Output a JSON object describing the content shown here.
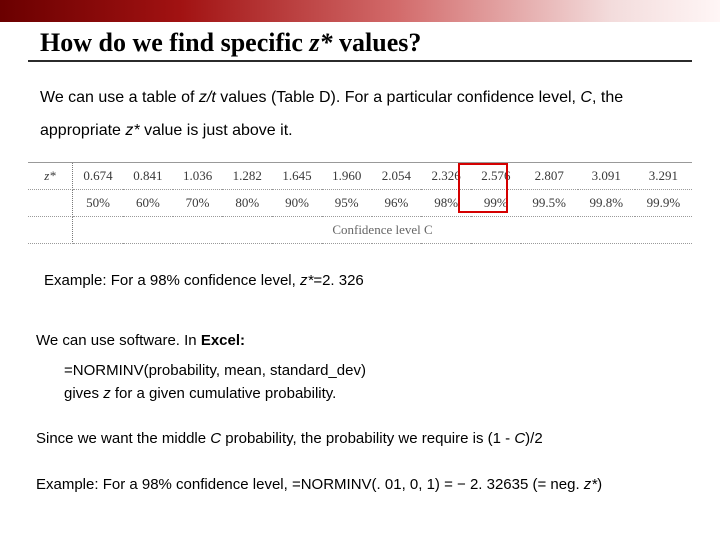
{
  "header": {
    "title_pre": "How do we find specific ",
    "title_z": "z*",
    "title_post": " values?"
  },
  "body": {
    "p1_a": "We can use a table of ",
    "p1_b": "z/t",
    "p1_c": " values (Table D). For a particular confidence level, ",
    "p1_d": "C",
    "p1_e": ", the appropriate ",
    "p1_f": "z*",
    "p1_g": " value is just above it."
  },
  "table": {
    "row1_label": "z*",
    "row2_label": "",
    "caption": "Confidence level C",
    "z": [
      "0.674",
      "0.841",
      "1.036",
      "1.282",
      "1.645",
      "1.960",
      "2.054",
      "2.326",
      "2.576",
      "2.807",
      "3.091",
      "3.291"
    ],
    "c": [
      "50%",
      "60%",
      "70%",
      "80%",
      "90%",
      "95%",
      "96%",
      "98%",
      "99%",
      "99.5%",
      "99.8%",
      "99.9%"
    ]
  },
  "example1": {
    "a": "Example: For a 98% confidence level, ",
    "b": "z*",
    "c": "=2. 326"
  },
  "software": {
    "line": "We can use software. In ",
    "bold": "Excel:"
  },
  "excel": {
    "l1": "=NORMINV(probability, mean, standard_dev)",
    "l2a": "gives ",
    "l2b": "z",
    "l2c": " for a given cumulative probability."
  },
  "middle": {
    "a": "Since we want the middle ",
    "b": "C",
    "c": " probability, the probability we require is (1 - ",
    "d": "C",
    "e": ")/2"
  },
  "example2": {
    "a": "Example: For a 98% confidence level, =NORMINV(. 01, 0, 1) = − 2. 32635 (= neg. ",
    "b": "z*",
    "c": ")"
  },
  "chart_data": {
    "type": "table",
    "title": "z* critical values for confidence level C",
    "columns": [
      "z*",
      "Confidence level C"
    ],
    "rows": [
      {
        "z_star": 0.674,
        "C": "50%"
      },
      {
        "z_star": 0.841,
        "C": "60%"
      },
      {
        "z_star": 1.036,
        "C": "70%"
      },
      {
        "z_star": 1.282,
        "C": "80%"
      },
      {
        "z_star": 1.645,
        "C": "90%"
      },
      {
        "z_star": 1.96,
        "C": "95%"
      },
      {
        "z_star": 2.054,
        "C": "96%"
      },
      {
        "z_star": 2.326,
        "C": "98%"
      },
      {
        "z_star": 2.576,
        "C": "99%"
      },
      {
        "z_star": 2.807,
        "C": "99.5%"
      },
      {
        "z_star": 3.091,
        "C": "99.8%"
      },
      {
        "z_star": 3.291,
        "C": "99.9%"
      }
    ],
    "highlight": {
      "z_star": 2.326,
      "C": "98%"
    }
  }
}
